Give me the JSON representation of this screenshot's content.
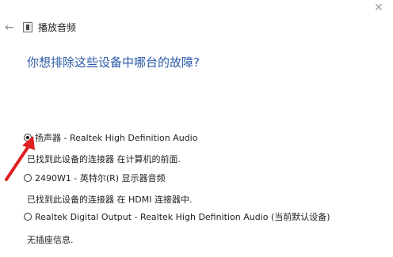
{
  "window": {
    "title": "播放音频",
    "back_icon": "back-arrow-icon",
    "close_icon": "close-icon"
  },
  "heading": "你想排除这些设备中哪台的故障?",
  "options": [
    {
      "label": "扬声器 - Realtek High Definition Audio",
      "selected": true,
      "description": "已找到此设备的连接器 在计算机的前面."
    },
    {
      "label": "2490W1 - 英特尔(R) 显示器音频",
      "selected": false,
      "description": "已找到此设备的连接器 在 HDMI 连接器中."
    },
    {
      "label": "Realtek Digital Output - Realtek High Definition Audio (当前默认设备)",
      "selected": false,
      "description": "无插座信息."
    }
  ],
  "colors": {
    "heading": "#2a5aa8",
    "annotation_arrow": "#e02020"
  }
}
